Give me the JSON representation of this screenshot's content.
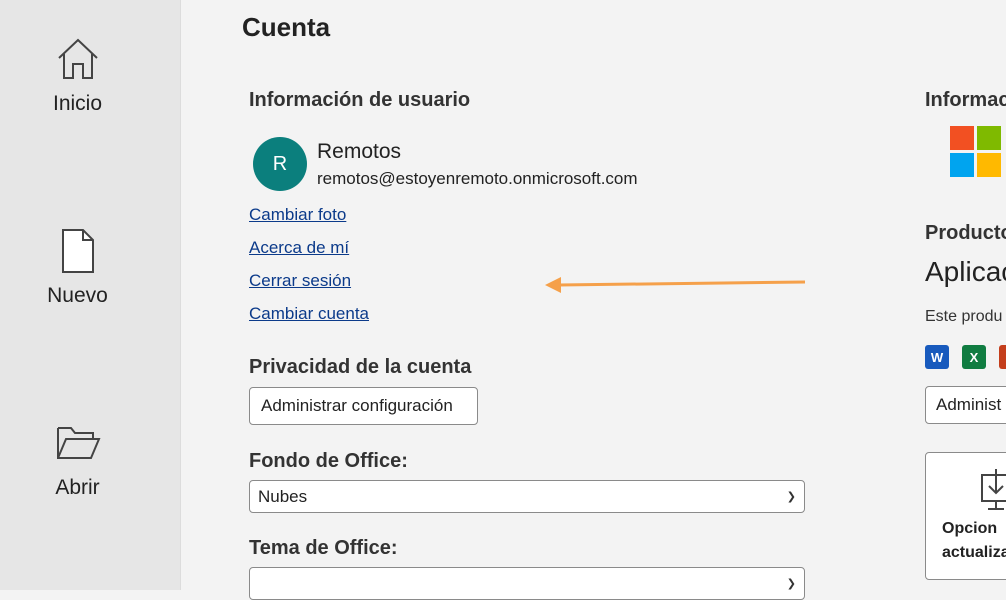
{
  "sidebar": {
    "items": [
      {
        "label": "Inicio",
        "icon": "home-icon"
      },
      {
        "label": "Nuevo",
        "icon": "new-document-icon"
      },
      {
        "label": "Abrir",
        "icon": "open-folder-icon"
      }
    ]
  },
  "page": {
    "title": "Cuenta"
  },
  "user_info": {
    "title": "Información de usuario",
    "avatar_initial": "R",
    "name": "Remotos",
    "email": "remotos@estoyenremoto.onmicrosoft.com",
    "links": [
      "Cambiar foto",
      "Acerca de mí",
      "Cerrar sesión",
      "Cambiar cuenta"
    ]
  },
  "privacy": {
    "title": "Privacidad de la cuenta",
    "button_label": "Administrar configuración"
  },
  "background": {
    "title": "Fondo de Office:",
    "selected": "Nubes"
  },
  "theme": {
    "title": "Tema de Office:",
    "selected": ""
  },
  "product_info": {
    "title": "Informac",
    "products_title": "Producto",
    "app_name": "Aplicac",
    "product_text": "Este produ",
    "manage_button": "Administ",
    "update_label_1": "Opcion",
    "update_label_2": "actualiza",
    "app_icons": [
      "word-icon",
      "excel-icon",
      "powerpoint-icon"
    ]
  },
  "colors": {
    "avatar": "#0b7f7d",
    "link": "#0b3a8a",
    "annotation_arrow": "#f5a04a",
    "ms_red": "#f25022",
    "ms_green": "#7fba00",
    "ms_blue": "#00a4ef",
    "ms_yellow": "#ffb900"
  }
}
